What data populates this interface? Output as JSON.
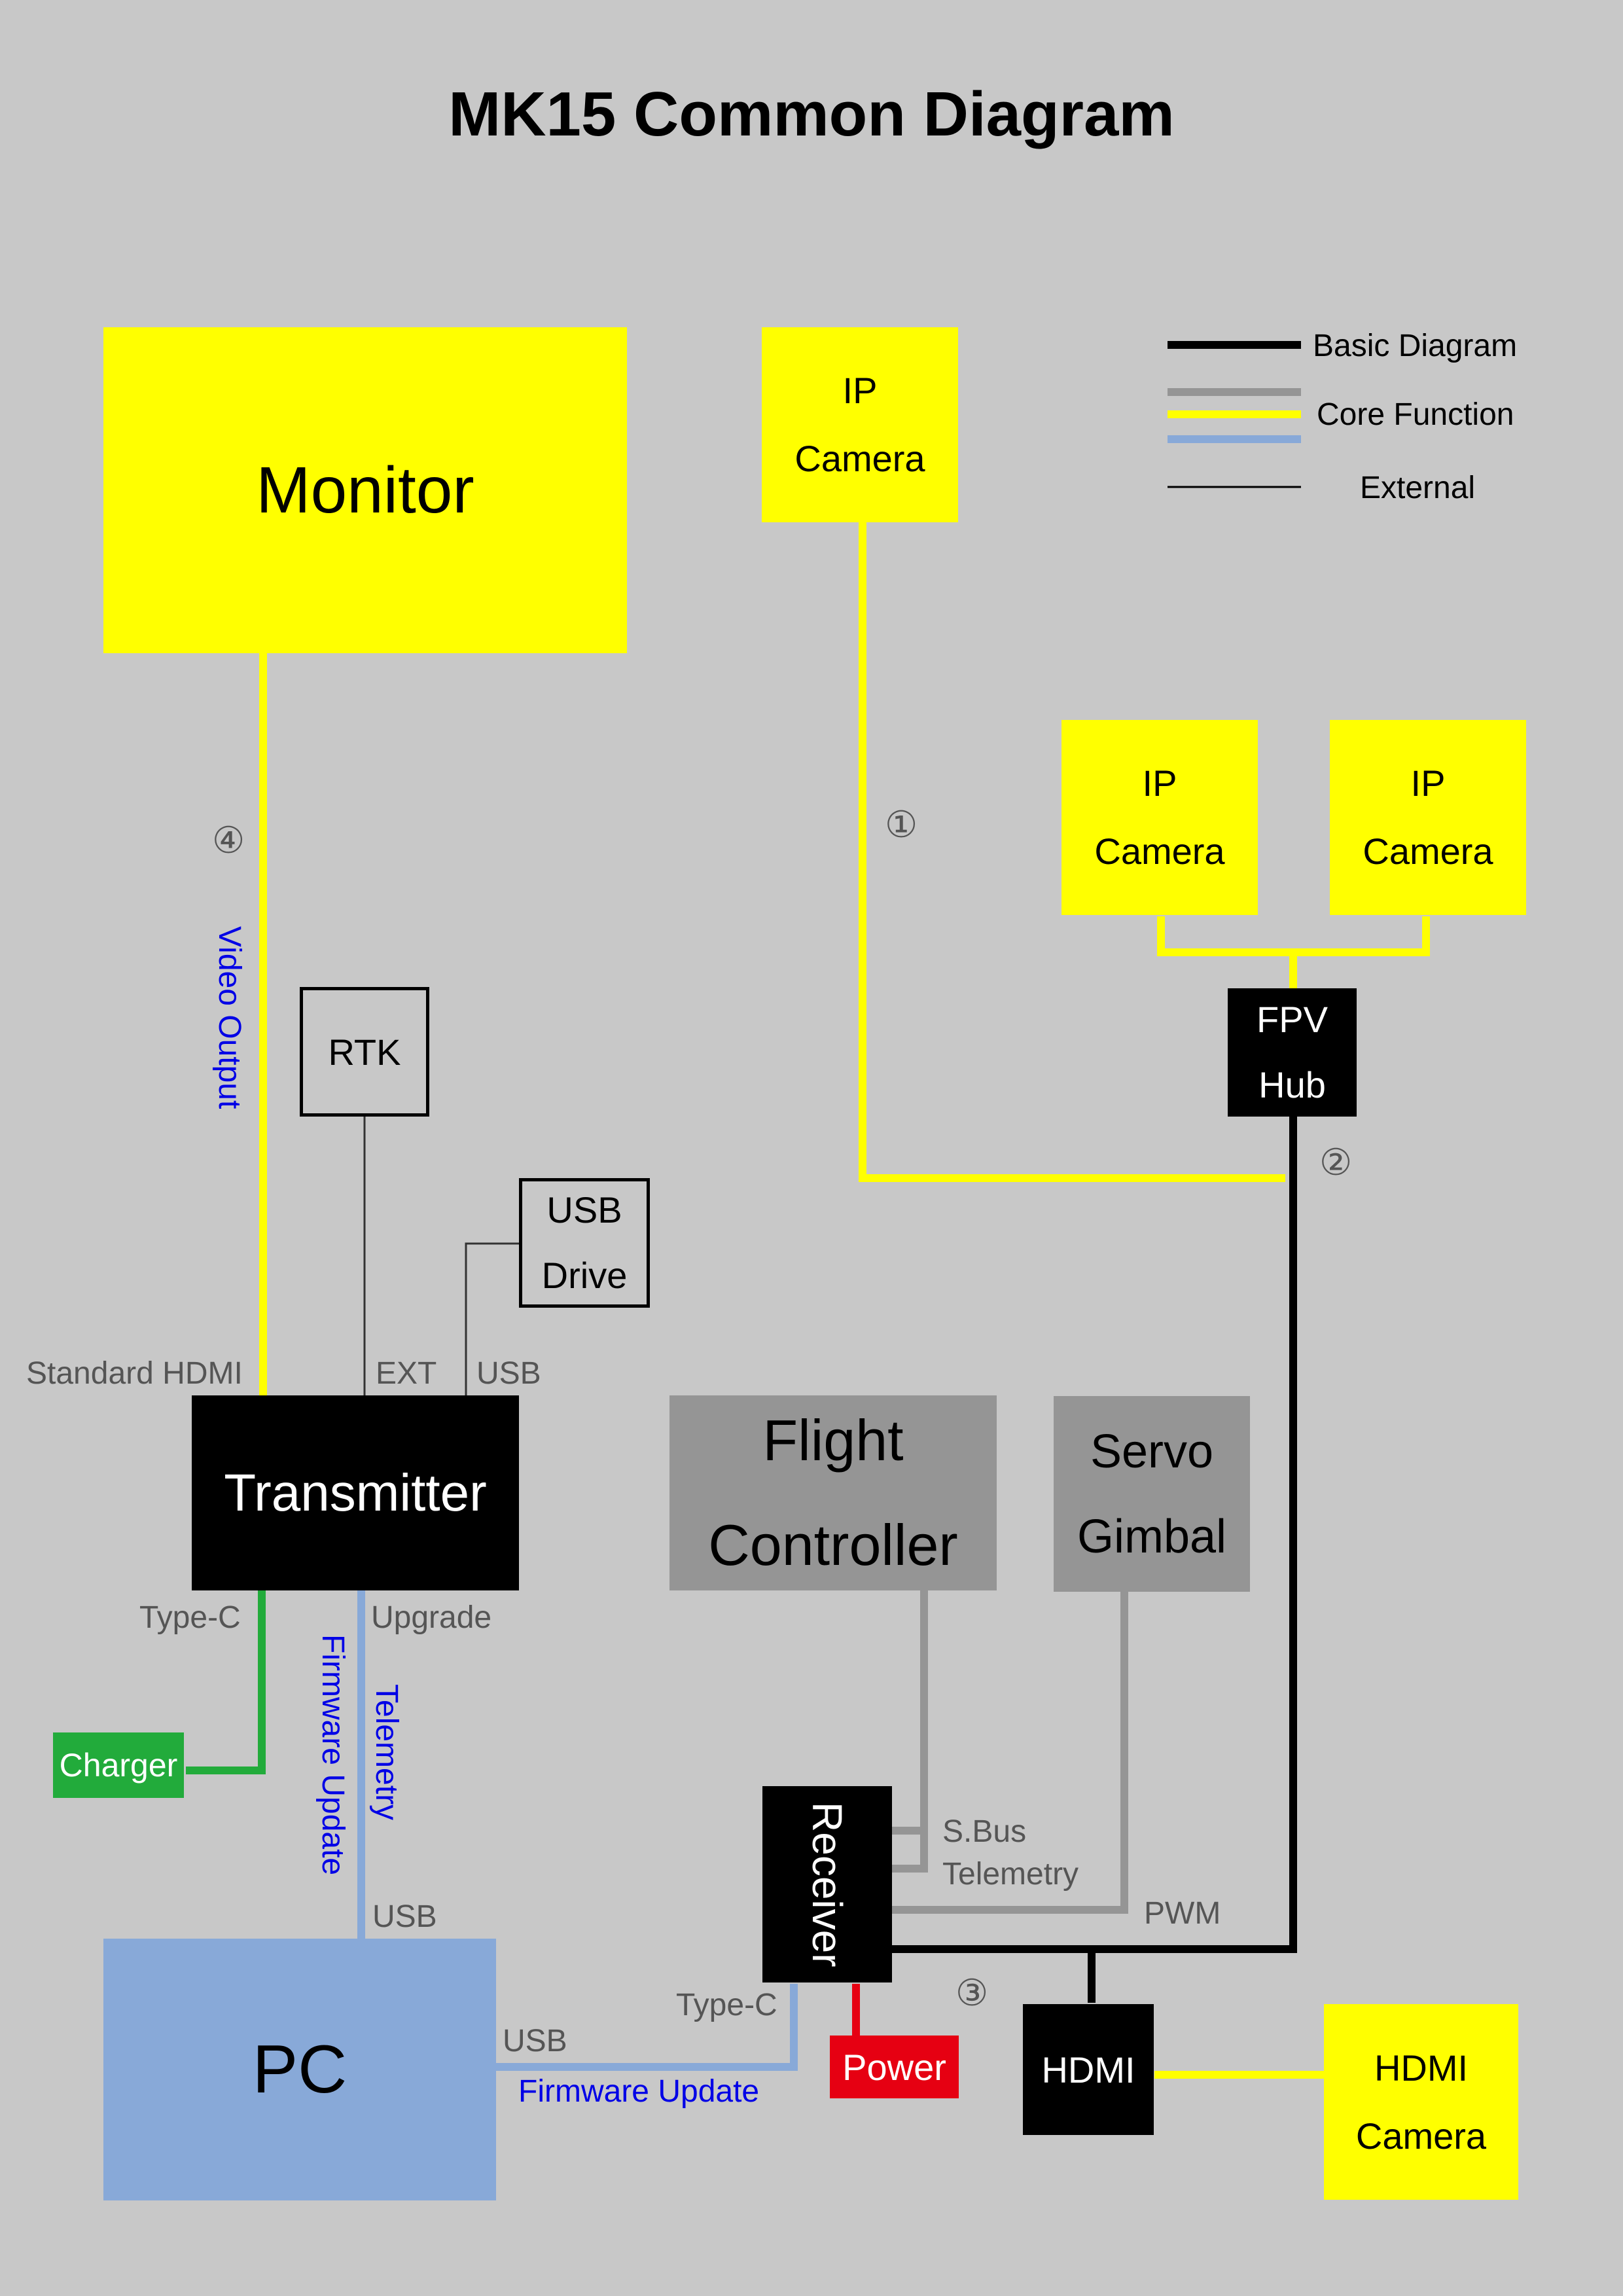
{
  "title": "MK15 Common Diagram",
  "legend": {
    "basic": "Basic Diagram",
    "core": "Core Function",
    "external": "External",
    "colors": {
      "basic": "#000000",
      "core_gray": "#959595",
      "core_yellow": "#ffff00",
      "core_blue": "#88a9d8",
      "external": "#000000"
    }
  },
  "nodes": {
    "monitor": "Monitor",
    "ip_camera_top": [
      "IP",
      "Camera"
    ],
    "ip_camera_left": [
      "IP",
      "Camera"
    ],
    "ip_camera_right": [
      "IP",
      "Camera"
    ],
    "fpv_hub": [
      "FPV",
      "Hub"
    ],
    "rtk": "RTK",
    "usb_drive": [
      "USB",
      "Drive"
    ],
    "transmitter": "Transmitter",
    "flight_controller": [
      "Flight",
      "Controller"
    ],
    "servo_gimbal": [
      "Servo",
      "Gimbal"
    ],
    "charger": "Charger",
    "receiver": "Receiver",
    "power": "Power",
    "pc": "PC",
    "hdmi": "HDMI",
    "hdmi_camera": [
      "HDMI",
      "Camera"
    ]
  },
  "port_labels": {
    "standard_hdmi": "Standard HDMI",
    "ext": "EXT",
    "usb_tx": "USB",
    "type_c_tx": "Type-C",
    "upgrade": "Upgrade",
    "usb_pc_top": "USB",
    "usb_pc_right": "USB",
    "type_c_rx": "Type-C",
    "sbus": "S.Bus",
    "telemetry_rx": "Telemetry",
    "pwm": "PWM"
  },
  "link_labels": {
    "video_output": "Video Output",
    "firmware_update_v": "Firmware Update",
    "telemetry_v": "Telemetry",
    "firmware_update_h": "Firmware Update"
  },
  "markers": {
    "m1": "①",
    "m2": "②",
    "m3": "③",
    "m4": "④"
  }
}
